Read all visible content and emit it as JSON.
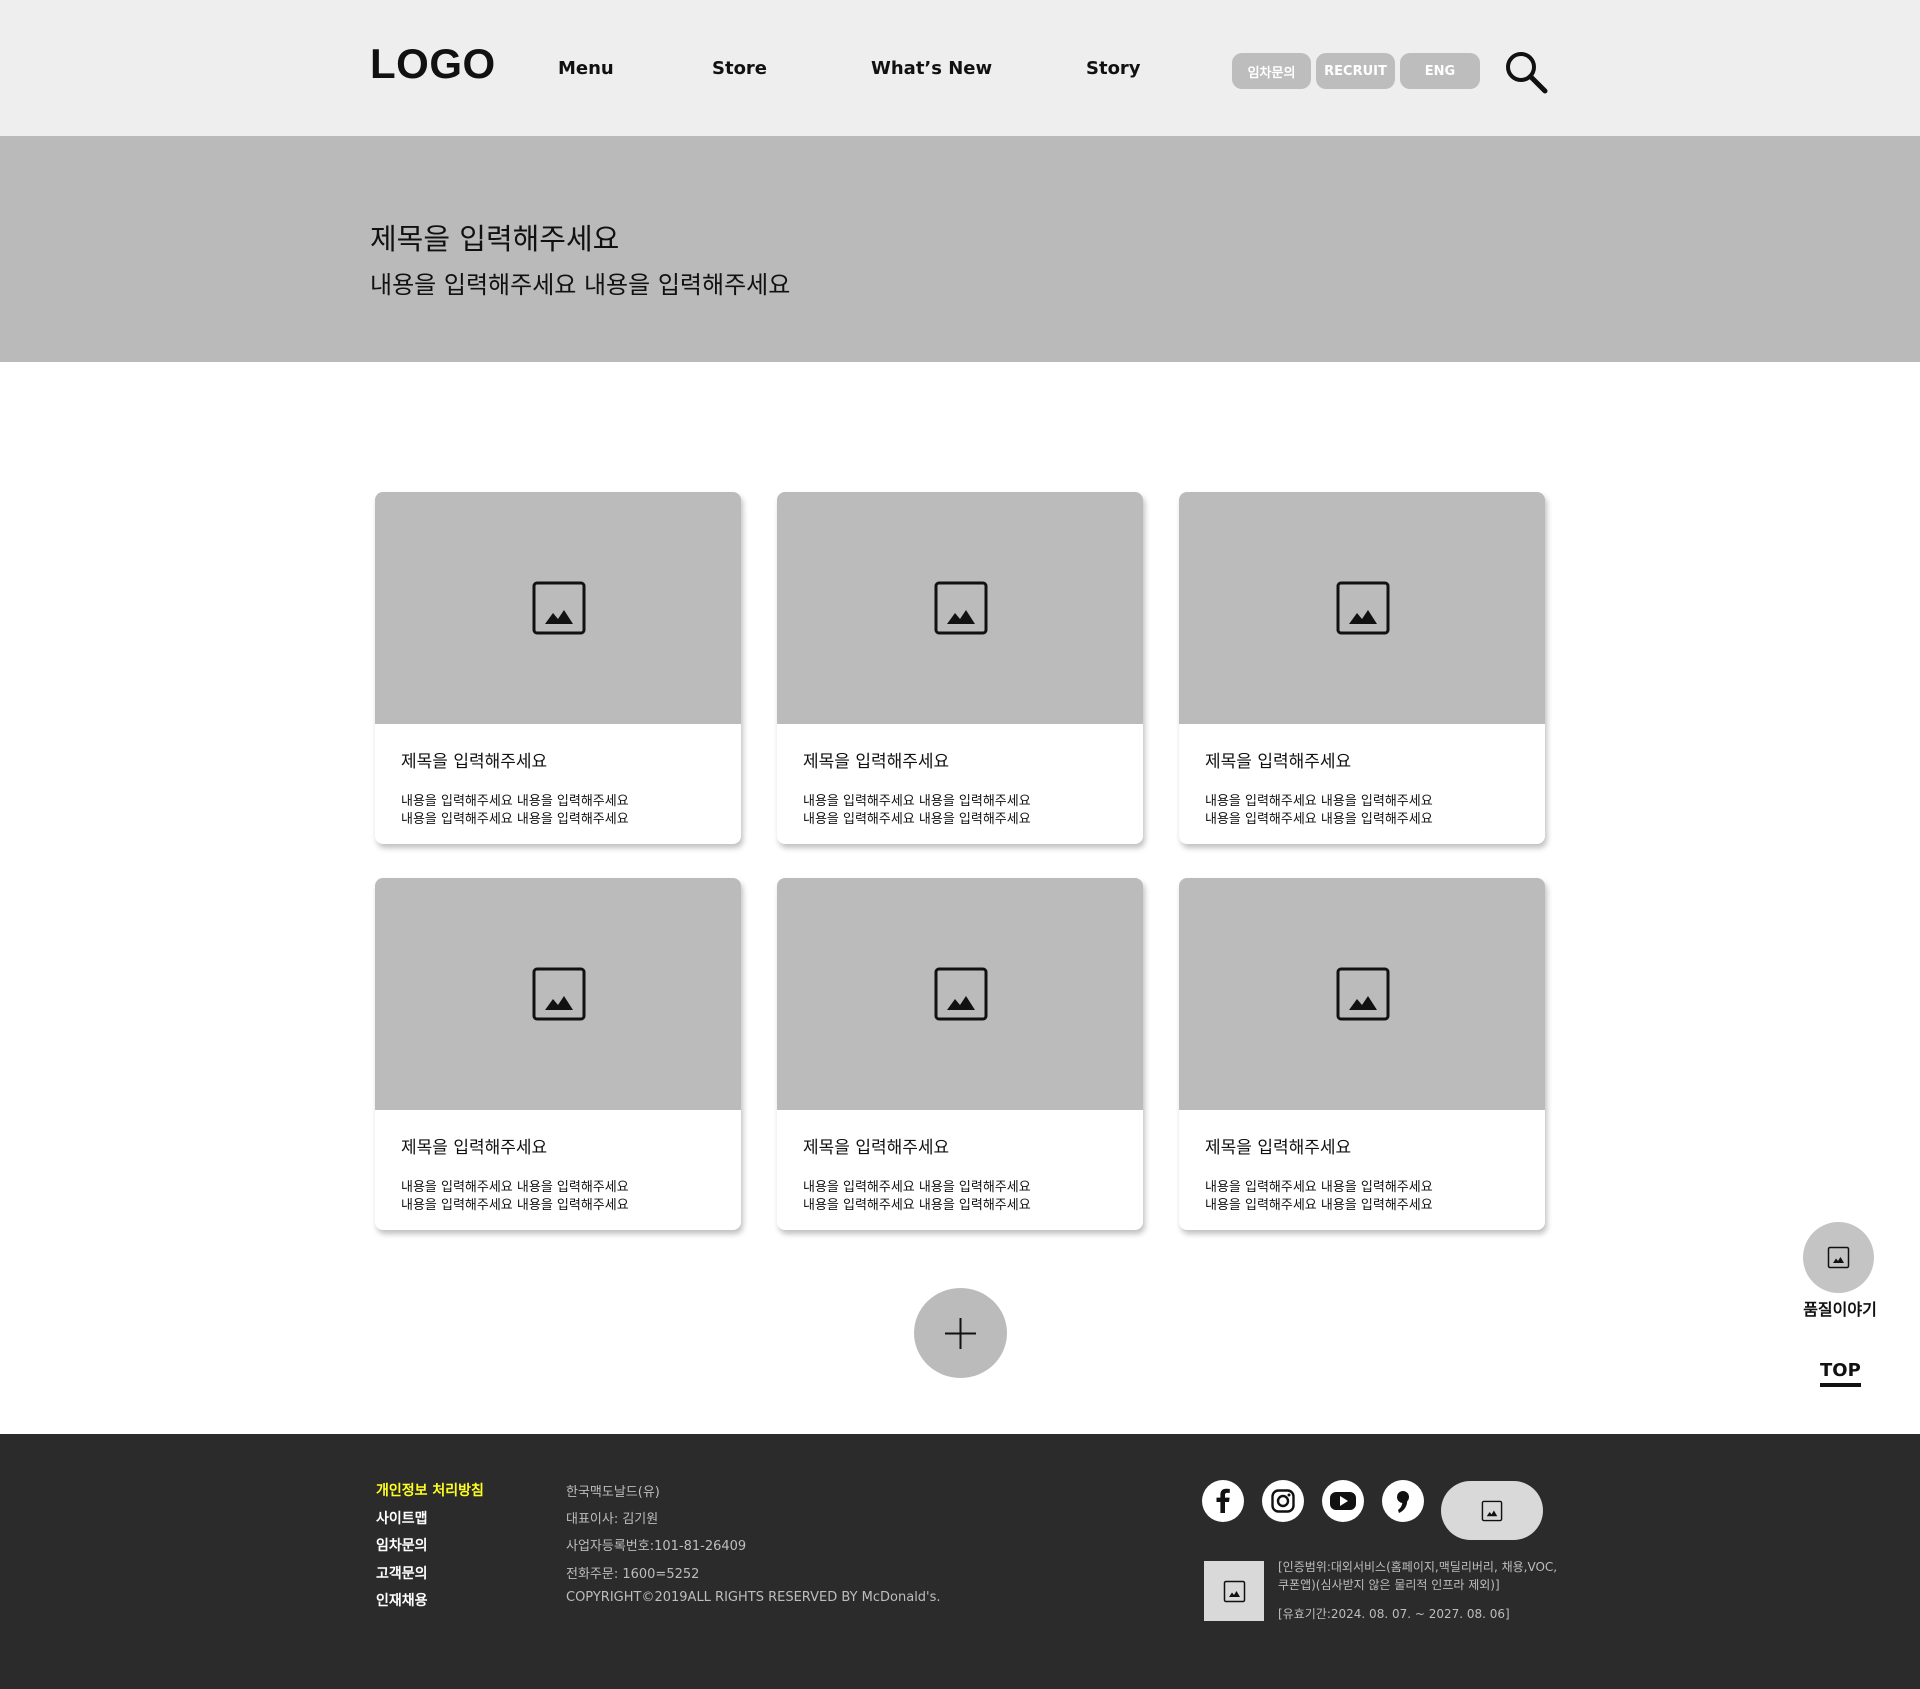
{
  "header": {
    "logo": "LOGO",
    "nav": [
      "Menu",
      "Store",
      "What’s New",
      "Story"
    ],
    "pills": [
      "임차문의",
      "RECRUIT",
      "ENG"
    ],
    "search_icon": "search-icon"
  },
  "hero": {
    "title": "제목을 입력해주세요",
    "subtitle": "내용을 입력해주세요 내용을 입력해주세요"
  },
  "cards": [
    {
      "title": "제목을 입력해주세요",
      "line1": "내용을 입력해주세요 내용을 입력해주세요",
      "line2": "내용을 입력해주세요 내용을 입력해주세요"
    },
    {
      "title": "제목을 입력해주세요",
      "line1": "내용을 입력해주세요 내용을 입력해주세요",
      "line2": "내용을 입력해주세요 내용을 입력해주세요"
    },
    {
      "title": "제목을 입력해주세요",
      "line1": "내용을 입력해주세요 내용을 입력해주세요",
      "line2": "내용을 입력해주세요 내용을 입력해주세요"
    },
    {
      "title": "제목을 입력해주세요",
      "line1": "내용을 입력해주세요 내용을 입력해주세요",
      "line2": "내용을 입력해주세요 내용을 입력해주세요"
    },
    {
      "title": "제목을 입력해주세요",
      "line1": "내용을 입력해주세요 내용을 입력해주세요",
      "line2": "내용을 입력해주세요 내용을 입력해주세요"
    },
    {
      "title": "제목을 입력해주세요",
      "line1": "내용을 입력해주세요 내용을 입력해주세요",
      "line2": "내용을 입력해주세요 내용을 입력해주세요"
    }
  ],
  "floating": {
    "label": "품질이야기",
    "top": "TOP"
  },
  "footer": {
    "links": [
      "개인정보 처리방침",
      "사이트맵",
      "임차문의",
      "고객문의",
      "인재채용"
    ],
    "info": [
      "한국맥도날드(유)",
      "대표이사: 김기원",
      "사업자등록번호:101-81-26409",
      "전화주문: 1600=5252",
      "COPYRIGHT©2019ALL RIGHTS RESERVED BY McDonald's."
    ],
    "social": [
      "facebook-icon",
      "instagram-icon",
      "youtube-icon",
      "blog-icon"
    ],
    "cert_line1": "[인증범위:대외서비스(홈페이지,맥딜리버리, 채용,VOC,",
    "cert_line2": "쿠폰앱)(심사받지 않은 물리적 인프라 제외)]",
    "cert_period": "[유효기간:2024. 08. 07. ~ 2027. 08. 06]"
  },
  "colors": {
    "header_bg": "#eeeeee",
    "hero_bg": "#bababa",
    "placeholder": "#bbbbbb",
    "footer_bg": "#2b2b2b",
    "footer_highlight": "#ffff1f"
  }
}
